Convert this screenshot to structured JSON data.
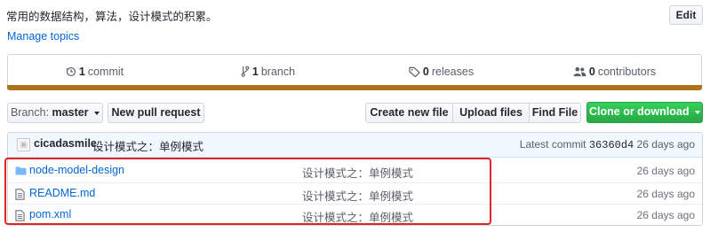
{
  "repo": {
    "description": "常用的数据结构，算法，设计模式的积累。",
    "edit_label": "Edit",
    "manage_topics": "Manage topics"
  },
  "summary": {
    "commits": {
      "num": "1",
      "label": "commit",
      "icon": "history-icon"
    },
    "branches": {
      "num": "1",
      "label": "branch",
      "icon": "git-branch-icon"
    },
    "releases": {
      "num": "0",
      "label": "releases",
      "icon": "tag-icon"
    },
    "contributors": {
      "num": "0",
      "label": "contributors",
      "icon": "people-icon"
    },
    "language_color": "#b07219"
  },
  "toolbar": {
    "branch_label": "Branch:",
    "branch_value": "master",
    "new_pr": "New pull request",
    "create_file": "Create new file",
    "upload_files": "Upload files",
    "find_file": "Find File",
    "clone": "Clone or download"
  },
  "commit_tease": {
    "author": "cicadasmile",
    "message": "设计模式之：单例模式",
    "latest_label": "Latest commit",
    "sha": "36360d4",
    "age": "26 days ago"
  },
  "files": [
    {
      "name": "node-model-design",
      "type": "directory",
      "icon": "folder-icon",
      "message": "设计模式之：单例模式",
      "age": "26 days ago"
    },
    {
      "name": "README.md",
      "type": "file",
      "icon": "file-icon",
      "message": "设计模式之：单例模式",
      "age": "26 days ago"
    },
    {
      "name": "pom.xml",
      "type": "file",
      "icon": "file-icon",
      "message": "设计模式之：单例模式",
      "age": "26 days ago"
    }
  ],
  "colors": {
    "link": "#0366d6",
    "clone_button": "#28a745",
    "highlight_box": "#e02424",
    "commit_bar_bg": "#f1f8ff"
  }
}
